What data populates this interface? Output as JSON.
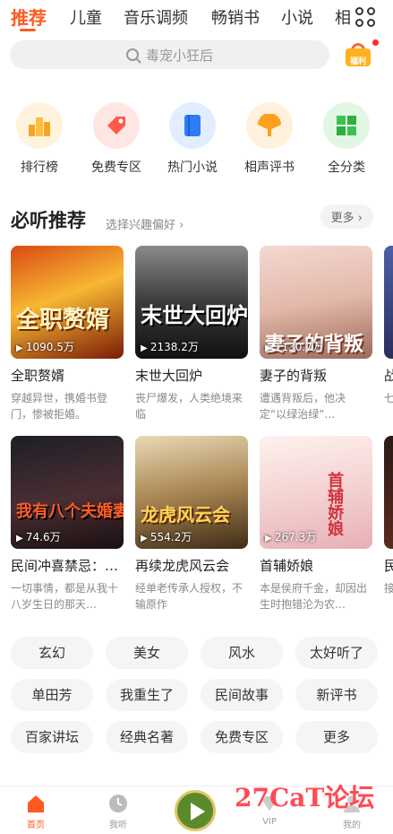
{
  "tabs": [
    "推荐",
    "儿童",
    "音乐调频",
    "畅销书",
    "小说",
    "相"
  ],
  "search": {
    "placeholder": "毒宠小狂后"
  },
  "welfare_label": "福利",
  "quick_links": [
    {
      "label": "排行榜",
      "icon": "trophy-icon",
      "color": "#f5a623"
    },
    {
      "label": "免费专区",
      "icon": "tag-icon",
      "color": "#ff5a4a"
    },
    {
      "label": "热门小说",
      "icon": "book-icon",
      "color": "#2f7df6"
    },
    {
      "label": "相声评书",
      "icon": "fan-icon",
      "color": "#ff9f1a"
    },
    {
      "label": "全分类",
      "icon": "grid-icon",
      "color": "#3cc24f"
    }
  ],
  "section": {
    "title": "必听推荐",
    "subtitle": "选择兴趣偏好 ›",
    "more": "更多 ›"
  },
  "books": [
    {
      "cover_title": "全职赘婿",
      "plays": "1090.5万",
      "title": "全职赘婿",
      "desc": "穿越异世，携婚书登门，惨被拒婚。"
    },
    {
      "cover_title": "末世大回炉",
      "plays": "2138.2万",
      "title": "末世大回炉",
      "desc": "丧尸爆发，人类绝境来临"
    },
    {
      "cover_title": "妻子的背叛",
      "plays": "1130.7万",
      "title": "妻子的背叛",
      "desc": "遭遇背叛后，他决定“以绿治绿”…"
    },
    {
      "cover_title": "",
      "plays": "",
      "title": "战",
      "desc": "七"
    },
    {
      "cover_title": "我有八个夫婚妻",
      "plays": "74.6万",
      "title": "民间冲喜禁忌：…",
      "desc": "一切事情，都是从我十八岁生日的那天…"
    },
    {
      "cover_title": "龙虎风云会",
      "plays": "554.2万",
      "title": "再续龙虎风云会",
      "desc": "经单老传承人授权，不输原作"
    },
    {
      "cover_title": "首辅娇娘",
      "plays": "267.3万",
      "title": "首辅娇娘",
      "desc": "本是侯府千金，却因出生时抱错沦为农…"
    },
    {
      "cover_title": "",
      "plays": "",
      "title": "民",
      "desc": "接"
    }
  ],
  "tags": [
    "玄幻",
    "美女",
    "风水",
    "太好听了",
    "单田芳",
    "我重生了",
    "民间故事",
    "新评书",
    "百家讲坛",
    "经典名著",
    "免费专区",
    "更多"
  ],
  "nav": [
    "首页",
    "我听",
    "",
    "VIP",
    "我的"
  ],
  "watermark": "27CaT论坛",
  "colors": {
    "accent": "#ff5a1f"
  }
}
